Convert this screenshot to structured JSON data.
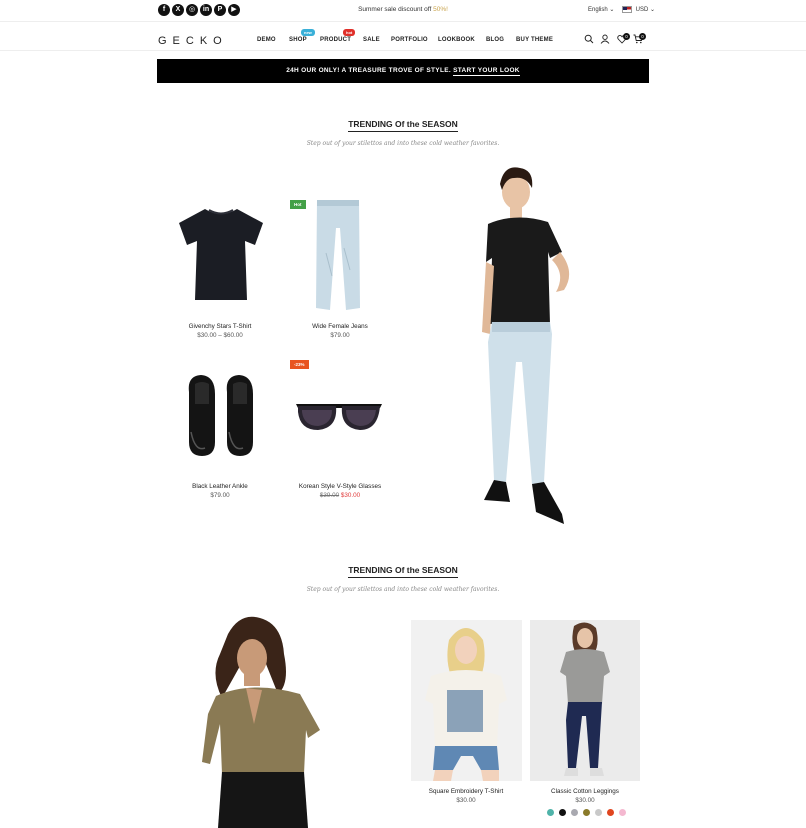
{
  "topbar": {
    "social_icons": [
      "facebook-icon",
      "x-twitter-icon",
      "instagram-icon",
      "linkedin-icon",
      "pinterest-icon",
      "youtube-icon"
    ],
    "promo_text": "Summer sale discount off ",
    "promo_highlight": "50%!",
    "language": "English",
    "currency": "USD"
  },
  "header": {
    "logo": "GECKO",
    "nav": [
      {
        "label": "DEMO"
      },
      {
        "label": "SHOP",
        "badge": "new"
      },
      {
        "label": "PRODUCT",
        "badge": "hot"
      },
      {
        "label": "SALE"
      },
      {
        "label": "PORTFOLIO"
      },
      {
        "label": "LOOKBOOK"
      },
      {
        "label": "BLOG"
      },
      {
        "label": "BUY THEME"
      }
    ],
    "wishlist_count": "0",
    "cart_count": "0"
  },
  "banner": {
    "text": "24H OUR ONLY! A TREASURE TROVE OF STYLE. ",
    "link": "START YOUR LOOK"
  },
  "section1": {
    "title": "TRENDING Of the SEASON",
    "subtitle": "Step out of your stilettos and into these cold weather favorites.",
    "products": [
      {
        "name": "Givenchy Stars T-Shirt",
        "price": "$30.00 – $60.00"
      },
      {
        "name": "Wide Female Jeans",
        "price": "$79.00",
        "label": "Hot"
      },
      {
        "name": "Black Leather Ankle",
        "price": "$79.00"
      },
      {
        "name": "Korean Style V-Style Glasses",
        "old_price": "$39.00",
        "sale_price": "$30.00",
        "label": "-23%"
      }
    ]
  },
  "section2": {
    "title": "TRENDING Of the SEASON",
    "subtitle": "Step out of your stilettos and into these cold weather favorites.",
    "products": [
      {
        "name": "Square Embroidery T-Shirt",
        "price": "$30.00"
      },
      {
        "name": "Classic Cotton Leggings",
        "price": "$30.00"
      }
    ],
    "swatches": [
      "#4fb3a9",
      "#111111",
      "#a9a9b0",
      "#8a7a2a",
      "#c9c9c9",
      "#e0451f",
      "#f4b8d0"
    ]
  },
  "colors": {
    "hot_label": "#43a047",
    "sale_label": "#e8541f",
    "new_badge": "#3ab0d8",
    "hot_badge": "#e0302a",
    "promo_accent": "#c8a24a"
  }
}
